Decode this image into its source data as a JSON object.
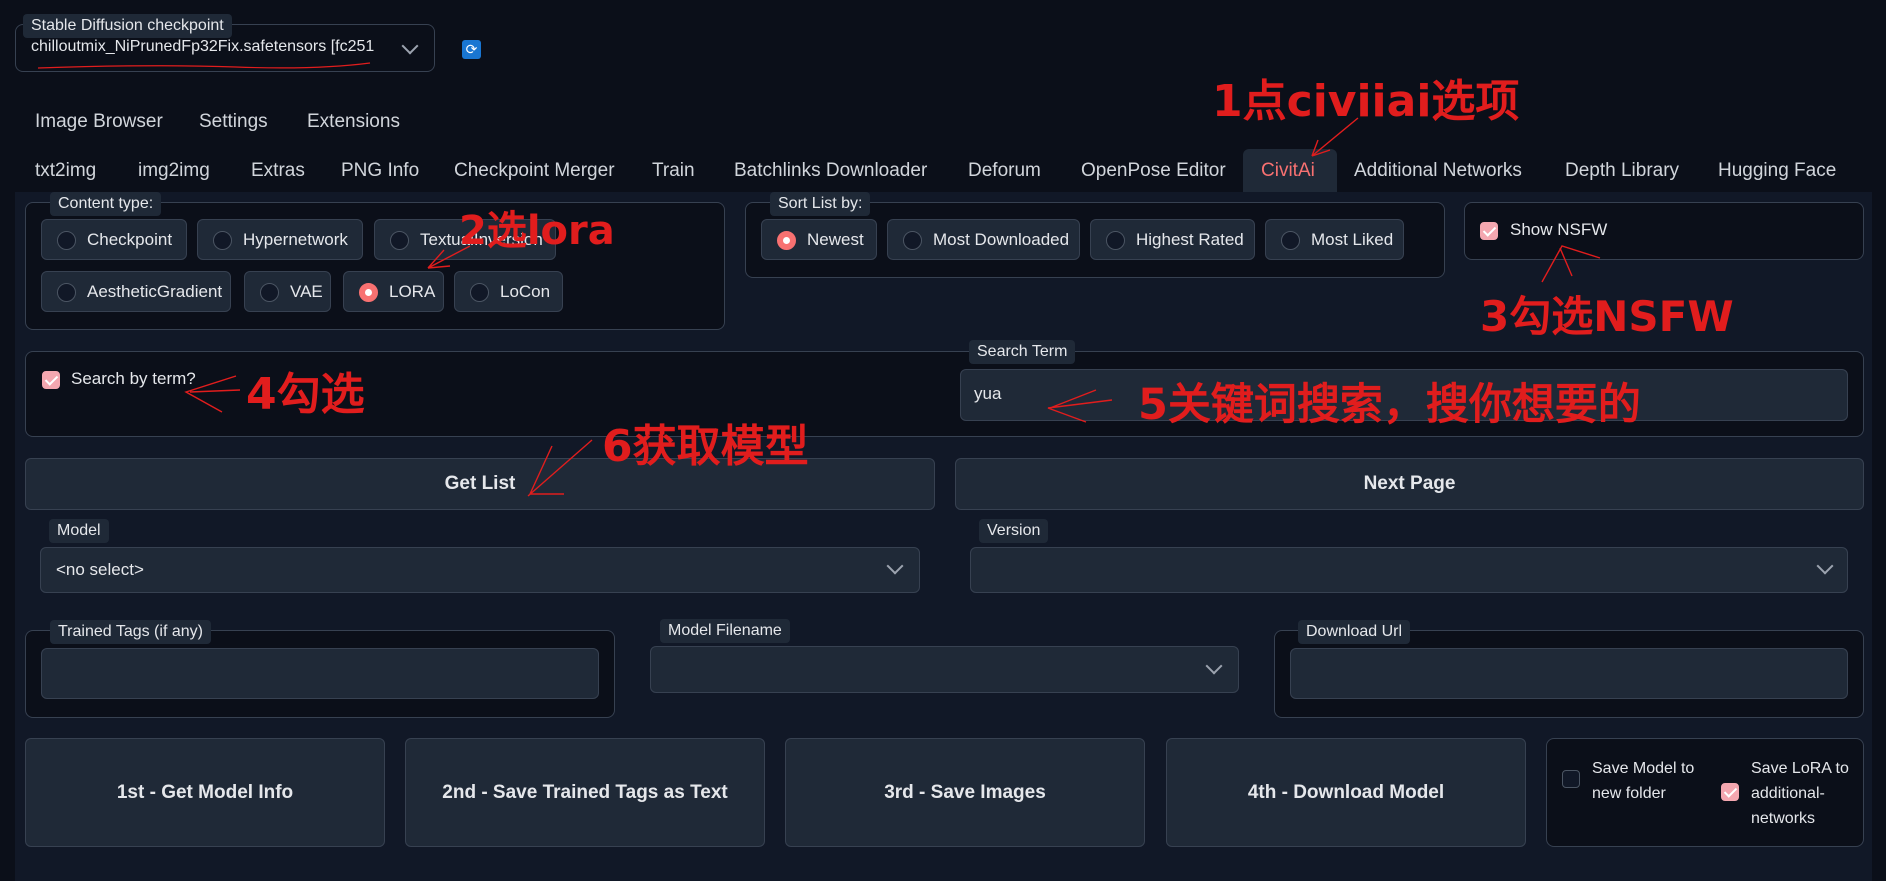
{
  "checkpoint": {
    "label": "Stable Diffusion checkpoint",
    "value": "chilloutmix_NiPrunedFp32Fix.safetensors [fc251"
  },
  "top_tabs": [
    "Image Browser",
    "Settings",
    "Extensions"
  ],
  "main_tabs": [
    "txt2img",
    "img2img",
    "Extras",
    "PNG Info",
    "Checkpoint Merger",
    "Train",
    "Batchlinks Downloader",
    "Deforum",
    "OpenPose Editor",
    "CivitAi",
    "Additional Networks",
    "Depth Library",
    "Hugging Face"
  ],
  "active_tab": "CivitAi",
  "content_type": {
    "label": "Content type:",
    "options": [
      "Checkpoint",
      "Hypernetwork",
      "TextualInversion",
      "AestheticGradient",
      "VAE",
      "LORA",
      "LoCon"
    ],
    "selected": "LORA"
  },
  "sort": {
    "label": "Sort List by:",
    "options": [
      "Newest",
      "Most Downloaded",
      "Highest Rated",
      "Most Liked"
    ],
    "selected": "Newest"
  },
  "show_nsfw": {
    "label": "Show NSFW",
    "checked": true
  },
  "search_by_term": {
    "label": "Search by term?",
    "checked": true
  },
  "search_term": {
    "label": "Search Term",
    "value": "yua"
  },
  "buttons": {
    "get_list": "Get List",
    "next_page": "Next Page"
  },
  "model": {
    "label": "Model",
    "value": "<no select>"
  },
  "version": {
    "label": "Version",
    "value": ""
  },
  "trained_tags": {
    "label": "Trained Tags (if any)",
    "value": ""
  },
  "model_filename": {
    "label": "Model Filename",
    "value": ""
  },
  "download_url": {
    "label": "Download Url",
    "value": ""
  },
  "actions": [
    "1st - Get Model Info",
    "2nd - Save Trained Tags as Text",
    "3rd - Save Images",
    "4th - Download Model"
  ],
  "save_options": {
    "save_model_folder": {
      "label": "Save Model to new folder",
      "checked": false
    },
    "save_lora": {
      "label": "Save LoRA to additional-networks",
      "checked": true
    }
  },
  "annotations": {
    "a1": "1点civiiai选项",
    "a2": "2选lora",
    "a3": "3勾选NSFW",
    "a4": "4勾选",
    "a5": "5关键词搜索，搜你想要的",
    "a6": "6获取模型"
  },
  "colors": {
    "background": "#0b0f19",
    "panel": "#111827",
    "accent": "#f87171",
    "annotation": "#e11d1d",
    "active_tab_text": "#f87171"
  }
}
